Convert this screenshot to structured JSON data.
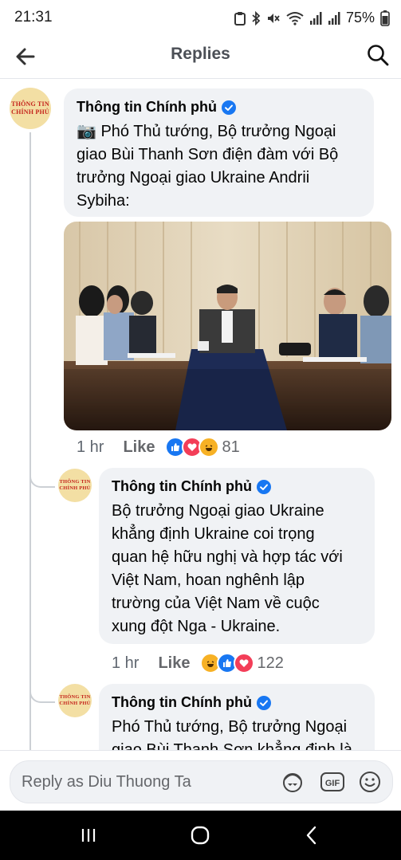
{
  "status_bar": {
    "time": "21:31",
    "battery": "75%"
  },
  "header": {
    "title": "Replies"
  },
  "comments": [
    {
      "avatar_text": [
        "THÔNG TIN",
        "CHÍNH PHỦ"
      ],
      "author": "Thông tin Chính phủ",
      "text_lines": [
        "📷 Phó Thủ tướng, Bộ trưởng Ngoại",
        "giao Bùi Thanh Sơn điện đàm với Bộ",
        "trưởng Ngoại giao Ukraine Andrii",
        "Sybiha:"
      ],
      "time": "1 hr",
      "like_label": "Like",
      "reaction_count": "81",
      "reactions": [
        "like-reaction",
        "love-reaction",
        "haha-reaction"
      ]
    },
    {
      "avatar_text": [
        "THÔNG TIN",
        "CHÍNH PHỦ"
      ],
      "author": "Thông tin Chính phủ",
      "text_lines": [
        "Bộ trưởng Ngoại giao Ukraine",
        "khẳng định Ukraine coi trọng",
        "quan hệ hữu nghị và hợp tác với",
        "Việt Nam, hoan nghênh lập",
        "trường của Việt Nam về cuộc",
        "xung đột Nga - Ukraine."
      ],
      "time": "1 hr",
      "like_label": "Like",
      "reaction_count": "122",
      "reactions": [
        "haha-reaction",
        "like-reaction",
        "love-reaction"
      ]
    },
    {
      "avatar_text": [
        "THÔNG TIN",
        "CHÍNH PHỦ"
      ],
      "author": "Thông tin Chính phủ",
      "text_lines": [
        "Phó Thủ tướng, Bộ trưởng Ngoại",
        "giao Bùi Thanh Sơn khẳng định là"
      ]
    }
  ],
  "composer": {
    "placeholder": "Reply as Diu Thuong Ta"
  },
  "colors": {
    "like_blue": "#1877f2",
    "love_red": "#f33e58",
    "haha_yellow": "#f7b125",
    "bubble_gray": "#f0f2f5",
    "avatar_gold": "#f3dfa4",
    "avatar_red": "#c4241c"
  }
}
